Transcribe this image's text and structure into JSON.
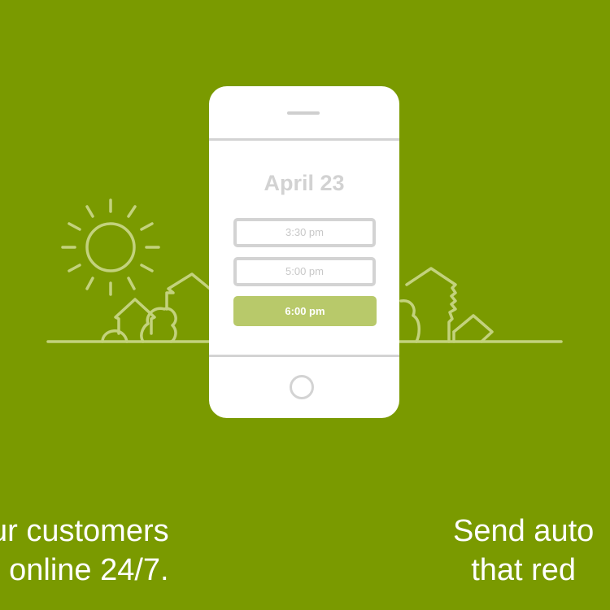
{
  "colors": {
    "background": "#7a9a00",
    "phone_body": "#ffffff",
    "line_art": "#c3d27d",
    "selected_slot": "#b8c96a",
    "muted_text": "#c8c8c8"
  },
  "phone": {
    "date": "April 23",
    "time_slots": [
      {
        "label": "3:30 pm",
        "selected": false
      },
      {
        "label": "5:00 pm",
        "selected": false
      },
      {
        "label": "6:00 pm",
        "selected": true
      }
    ]
  },
  "captions": {
    "left": {
      "line1": "ur customers",
      "line2": " online 24/7."
    },
    "right": {
      "line1": "Send auto",
      "line2": "that red"
    }
  },
  "icons": [
    "sun-icon",
    "bushes-left-icon",
    "bushes-right-icon",
    "home-button-icon"
  ]
}
